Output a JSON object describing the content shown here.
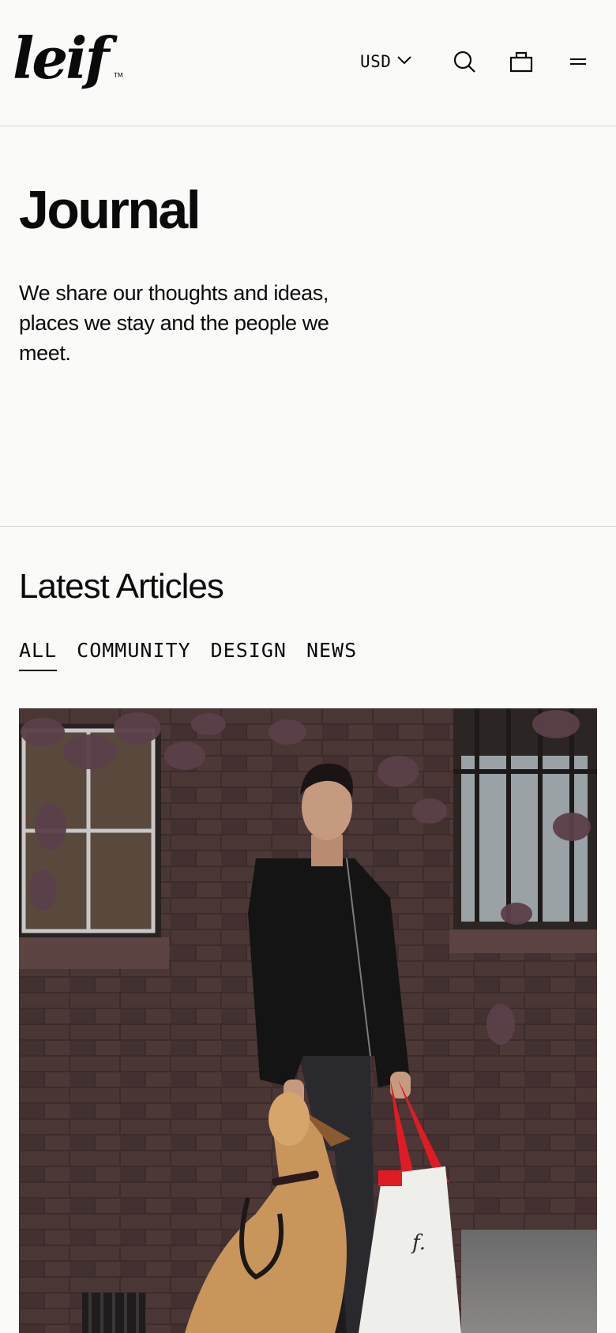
{
  "header": {
    "logo_text": "leif",
    "trademark": "TM",
    "currency_label": "USD",
    "icons": {
      "currency": "chevron-down-icon",
      "search": "search-icon",
      "cart": "shopping-bag-icon",
      "menu": "menu-icon"
    }
  },
  "hero": {
    "title": "Journal",
    "description": "We share our thoughts and ideas, places we stay and the people we meet."
  },
  "articles": {
    "title": "Latest Articles",
    "tabs": [
      {
        "label": "ALL",
        "active": true
      },
      {
        "label": "COMMUNITY",
        "active": false
      },
      {
        "label": "DESIGN",
        "active": false
      },
      {
        "label": "NEWS",
        "active": false
      }
    ]
  },
  "colors": {
    "background": "#fafaf9",
    "text": "#0a0a0a",
    "divider": "#d9d9d6",
    "brick": "#3b2a2a",
    "tote_handle": "#e01b24"
  }
}
